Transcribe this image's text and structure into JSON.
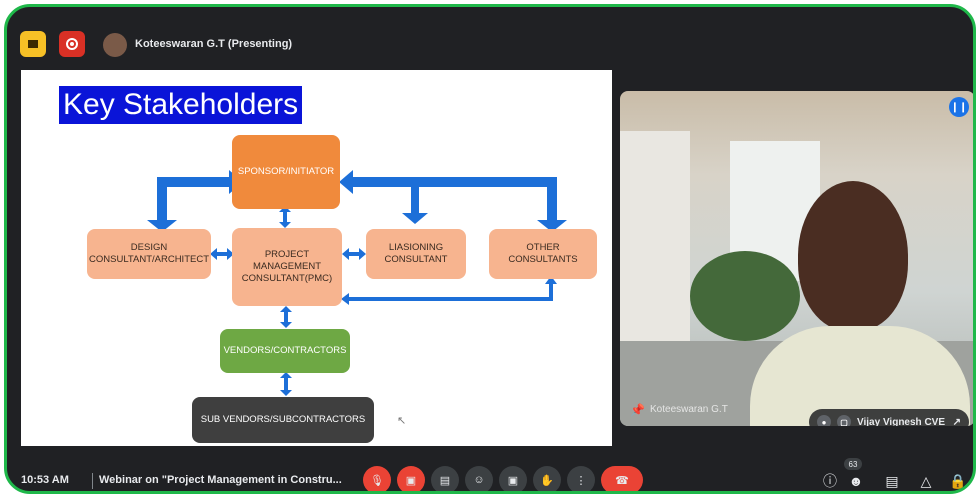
{
  "topbar": {
    "presenter_title": "Koteeswaran G.T (Presenting)"
  },
  "slide": {
    "title": "Key Stakeholders",
    "boxes": {
      "sponsor": "SPONSOR/INITIATOR",
      "design": "DESIGN CONSULTANT/ARCHITECT",
      "pmc": "PROJECT MANAGEMENT CONSULTANT(PMC)",
      "liaisoning": "LIASIONING CONSULTANT",
      "other": "OTHER CONSULTANTS",
      "vendors": "VENDORS/CONTRACTORS",
      "subvendors": "SUB VENDORS/SUBCONTRACTORS"
    },
    "colors": {
      "title_bg": "#0a14d8",
      "orange": "#f7b48f",
      "deep_orange": "#f08a3c",
      "green": "#6ea844",
      "dark": "#3f3f3f",
      "arrow": "#1d6fd8"
    }
  },
  "video": {
    "tile_name": "Koteeswaran G.T",
    "self_view_name": "Vijay Vignesh CVE"
  },
  "bottombar": {
    "time": "10:53 AM",
    "meeting_title": "Webinar on \"Project Management in Constru...",
    "participant_count": "63"
  },
  "icons": [
    "presentation-icon",
    "record-icon",
    "mic-off-icon",
    "camera-off-icon",
    "captions-icon",
    "emoji-icon",
    "present-icon",
    "raise-hand-icon",
    "more-icon",
    "end-call-icon",
    "info-icon",
    "people-icon",
    "chat-icon",
    "activities-icon",
    "lock-icon",
    "pin-icon",
    "expand-icon",
    "audio-icon"
  ]
}
